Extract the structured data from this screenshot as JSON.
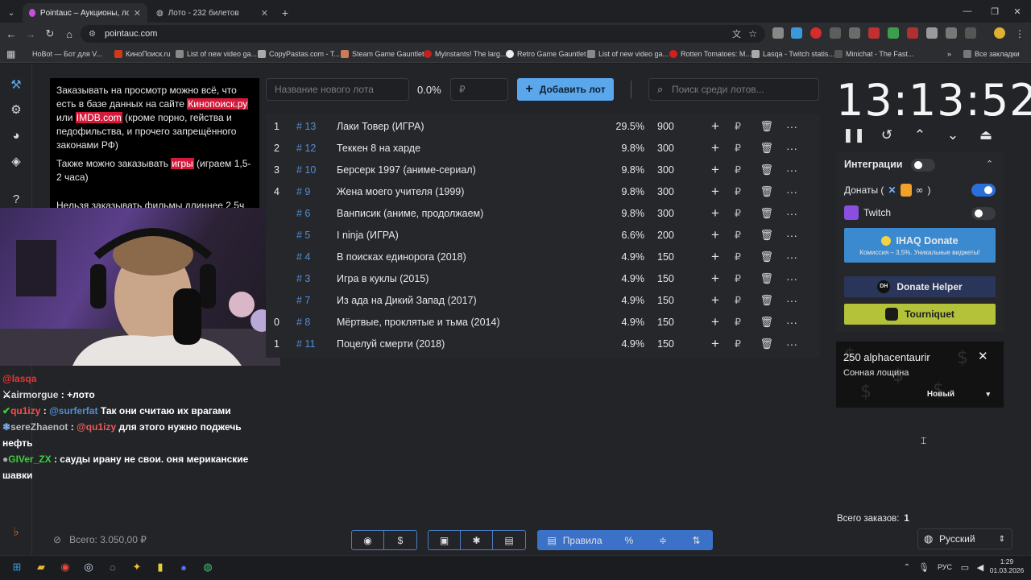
{
  "browser": {
    "tabs": [
      {
        "title": "Pointauc – Аукционы, лотерея"
      },
      {
        "title": "Лото - 232 билетов"
      }
    ],
    "new_tab_label": "+",
    "url": "pointauc.com",
    "bookmarks": [
      {
        "label": "HoBot — Бот для V..."
      },
      {
        "label": "КиноПоиск.ru"
      },
      {
        "label": "List of new video ga..."
      },
      {
        "label": "CopyPastas.com - T..."
      },
      {
        "label": "Steam Game Gauntlet"
      },
      {
        "label": "Myinstants! The larg..."
      },
      {
        "label": "Retro Game Gauntlet"
      },
      {
        "label": "List of new video ga..."
      },
      {
        "label": "Rotten Tomatoes: M..."
      },
      {
        "label": "Lasqa - Twitch statis..."
      },
      {
        "label": "Minichat - The Fast..."
      }
    ],
    "all_bookmarks_label": "Все закладки"
  },
  "rules": {
    "p1_a": "Заказывать на просмотр можно всё, что есть в базе данных на сайте ",
    "p1_link1": "Кинопоиск.ру",
    "p1_b": " или ",
    "p1_link2": "IMDB.com",
    "p1_c": " (кроме порно, гейства и педофильства, и прочего запрещённого законами РФ)",
    "p2_a": "Также можно заказывать ",
    "p2_link": "игры",
    "p2_b": " (играем 1,5-2 часа)",
    "p3": "Нельзя заказывать фильмы длиннее 2,5ч"
  },
  "controls": {
    "new_lot_placeholder": "Название нового лота",
    "percent": "0.0%",
    "amount_placeholder": "₽",
    "add_lot_label": "Добавить лот",
    "search_placeholder": "Поиск среди лотов..."
  },
  "lots": [
    {
      "num": "1",
      "id": "# 13",
      "name": "Лаки Товер (ИГРА)",
      "percent": "29.5%",
      "amount": "900"
    },
    {
      "num": "2",
      "id": "# 12",
      "name": "Теккен 8 на харде",
      "percent": "9.8%",
      "amount": "300"
    },
    {
      "num": "3",
      "id": "# 10",
      "name": "Берсерк 1997 (аниме-сериал)",
      "percent": "9.8%",
      "amount": "300"
    },
    {
      "num": "4",
      "id": "# 9",
      "name": "Жена моего учителя (1999)",
      "percent": "9.8%",
      "amount": "300"
    },
    {
      "num": "",
      "id": "# 6",
      "name": "Ванписик (аниме, продолжаем)",
      "percent": "9.8%",
      "amount": "300"
    },
    {
      "num": "",
      "id": "# 5",
      "name": "I ninja (ИГРА)",
      "percent": "6.6%",
      "amount": "200"
    },
    {
      "num": "",
      "id": "# 4",
      "name": "В поисках единорога (2018)",
      "percent": "4.9%",
      "amount": "150"
    },
    {
      "num": "",
      "id": "# 3",
      "name": "Игра в куклы (2015)",
      "percent": "4.9%",
      "amount": "150"
    },
    {
      "num": "",
      "id": "# 7",
      "name": "Из ада на Дикий Запад (2017)",
      "percent": "4.9%",
      "amount": "150"
    },
    {
      "num": "0",
      "id": "# 8",
      "name": "Мёртвые, проклятые и тьма (2014)",
      "percent": "4.9%",
      "amount": "150"
    },
    {
      "num": "1",
      "id": "# 11",
      "name": "Поцелуй смерти (2018)",
      "percent": "4.9%",
      "amount": "150"
    }
  ],
  "lot_actions": {
    "plus": "+",
    "currency": "₽",
    "more": "···"
  },
  "timer": {
    "value": "13:13:52"
  },
  "integrations": {
    "title": "Интеграции",
    "donations_label": "Донаты (",
    "donations_close": ")",
    "twitch_label": "Twitch",
    "ihaq_title": "IHAQ Donate",
    "ihaq_sub": "Комиссия – 3,5%. Уникальные виджеты!",
    "donate_helper": "Donate Helper",
    "tourniquet": "Tourniquet"
  },
  "alert": {
    "title": "250 alphacentaurir",
    "subtitle": "Сонная лощина",
    "status": "Новый"
  },
  "orders": {
    "label": "Всего заказов:",
    "count": "1"
  },
  "language": {
    "selected": "Русский"
  },
  "total": {
    "label": "Всего: 3.050,00 ₽"
  },
  "bottom_bar": {
    "rules_label": "Правила"
  },
  "chat": [
    {
      "user": "@lasqa",
      "text": ""
    },
    {
      "user": "airmorgue",
      "text": "+лото"
    },
    {
      "user": "qu1izy",
      "mention": "@surferfat",
      "text": "Так они считаю их врагами"
    },
    {
      "user": "sereZhaenot",
      "mention": "@qu1izy",
      "text": "для этого нужно поджечь нефть"
    },
    {
      "user": "GIVer_ZX",
      "text": "сауды ирану не свои. оня мериканские шавки"
    }
  ],
  "tray": {
    "lang": "РУС",
    "time": "1:29",
    "date": "01.03.2026"
  }
}
